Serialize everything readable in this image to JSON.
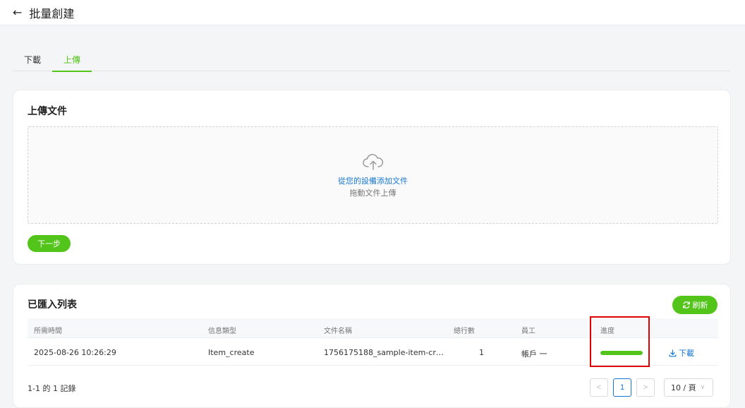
{
  "header": {
    "title": "批量創建",
    "back_icon": "arrow-left-icon"
  },
  "tabs": [
    {
      "label": "下載",
      "active": false
    },
    {
      "label": "上傳",
      "active": true
    }
  ],
  "upload": {
    "title": "上傳文件",
    "dropzone_icon": "cloud-upload-icon",
    "dropzone_link": "從您的設備添加文件",
    "dropzone_hint": "拖動文件上傳",
    "next_label": "下一步"
  },
  "list": {
    "title": "已匯入列表",
    "refresh_label": "刷新",
    "refresh_icon": "refresh-icon",
    "columns": [
      "所需時間",
      "信息類型",
      "文件名稱",
      "總行數",
      "員工",
      "進度"
    ],
    "rows": [
      {
        "time": "2025-08-26 10:26:29",
        "type": "Item_create",
        "file": "1756175188_sample-item-cr…",
        "total_rows": "1",
        "staff": "帳戶 一",
        "progress": 1.0,
        "action": "下載"
      }
    ],
    "record_count": "1-1 的 1 記錄",
    "pagination": {
      "prev": "<",
      "current_page": "1",
      "next": ">",
      "page_size": "10 / 頁"
    }
  },
  "colors": {
    "accent": "#52c41a",
    "link": "#1677d2",
    "highlight": "#e00000"
  }
}
